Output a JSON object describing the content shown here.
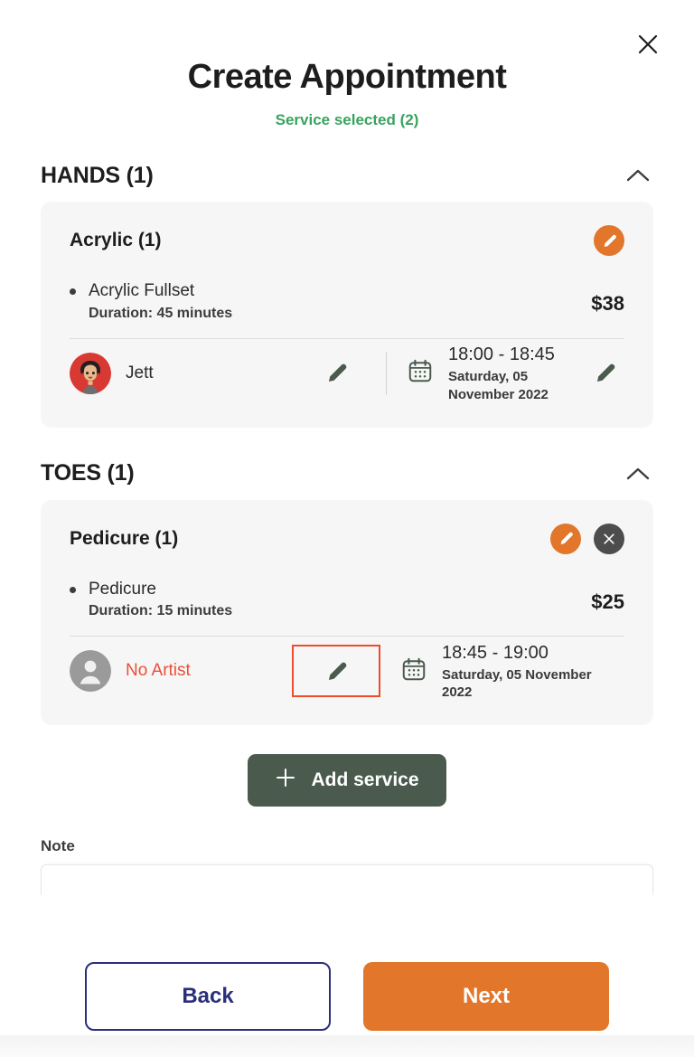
{
  "dialog": {
    "title": "Create Appointment",
    "subtitle": "Service selected (2)",
    "close_icon": "close-icon"
  },
  "sections": [
    {
      "title": "HANDS (1)",
      "collapse_icon": "chevron-up-icon",
      "card": {
        "name": "Acrylic (1)",
        "edit_icon": "pencil-icon",
        "has_remove": false,
        "service": {
          "name": "Acrylic Fullset",
          "duration": "Duration: 45 minutes",
          "price": "$38"
        },
        "artist": {
          "name": "Jett",
          "avatar": "avatar-jett",
          "is_none": false
        },
        "artist_edit_icon": "pencil-icon",
        "artist_edit_highlighted": false,
        "schedule": {
          "calendar_icon": "calendar-icon",
          "time": "18:00 - 18:45",
          "date": "Saturday, 05 November 2022",
          "edit_icon": "pencil-icon",
          "has_trailing_edit": true
        }
      }
    },
    {
      "title": "TOES (1)",
      "collapse_icon": "chevron-up-icon",
      "card": {
        "name": "Pedicure (1)",
        "edit_icon": "pencil-icon",
        "remove_icon": "close-circle-icon",
        "has_remove": true,
        "service": {
          "name": "Pedicure",
          "duration": "Duration: 15 minutes",
          "price": "$25"
        },
        "artist": {
          "name": "No Artist",
          "avatar": "avatar-placeholder-icon",
          "is_none": true
        },
        "artist_edit_icon": "pencil-icon",
        "artist_edit_highlighted": true,
        "schedule": {
          "calendar_icon": "calendar-icon",
          "time": "18:45 - 19:00",
          "date": "Saturday, 05 November 2022",
          "has_trailing_edit": false
        }
      }
    }
  ],
  "add_service": {
    "label": "Add service",
    "icon": "plus-icon"
  },
  "note": {
    "label": "Note",
    "value": "",
    "placeholder": ""
  },
  "footer": {
    "back_label": "Back",
    "next_label": "Next"
  },
  "colors": {
    "accent_orange": "#e2762b",
    "accent_green": "#38a35f",
    "dark_green": "#4a5b4d",
    "highlight_red": "#f04b2a",
    "no_artist_red": "#e8503a",
    "back_blue": "#2b2f7a",
    "card_bg": "#f6f6f6"
  }
}
